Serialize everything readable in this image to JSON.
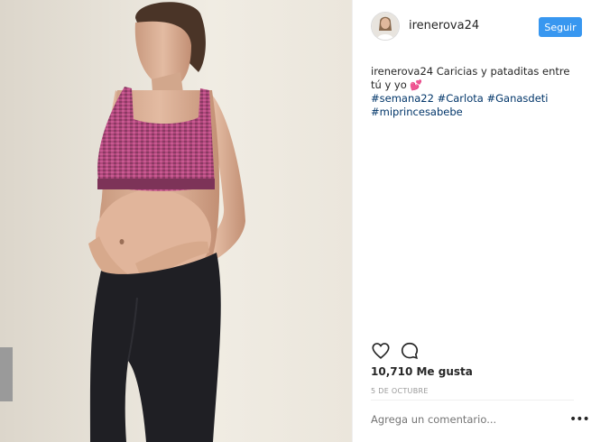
{
  "photo": {
    "icon": "post-photo"
  },
  "header": {
    "username": "irenerova24",
    "follow_label": "Seguir"
  },
  "caption": {
    "username": "irenerova24",
    "text": "Caricias y pataditas entre tú y yo",
    "emoji": "💕",
    "hashtags": [
      "#semana22",
      "#Carlota",
      "#Ganasdeti",
      "#miprincesabebe"
    ]
  },
  "actions": {
    "like_icon": "heart-icon",
    "comment_icon": "comment-icon"
  },
  "likes": "10,710 Me gusta",
  "date": "5 DE OCTUBRE",
  "comment": {
    "placeholder": "Agrega un comentario..."
  },
  "more": "•••",
  "colors": {
    "accent": "#3897f0",
    "hashtag": "#003569",
    "muted": "#999999"
  }
}
